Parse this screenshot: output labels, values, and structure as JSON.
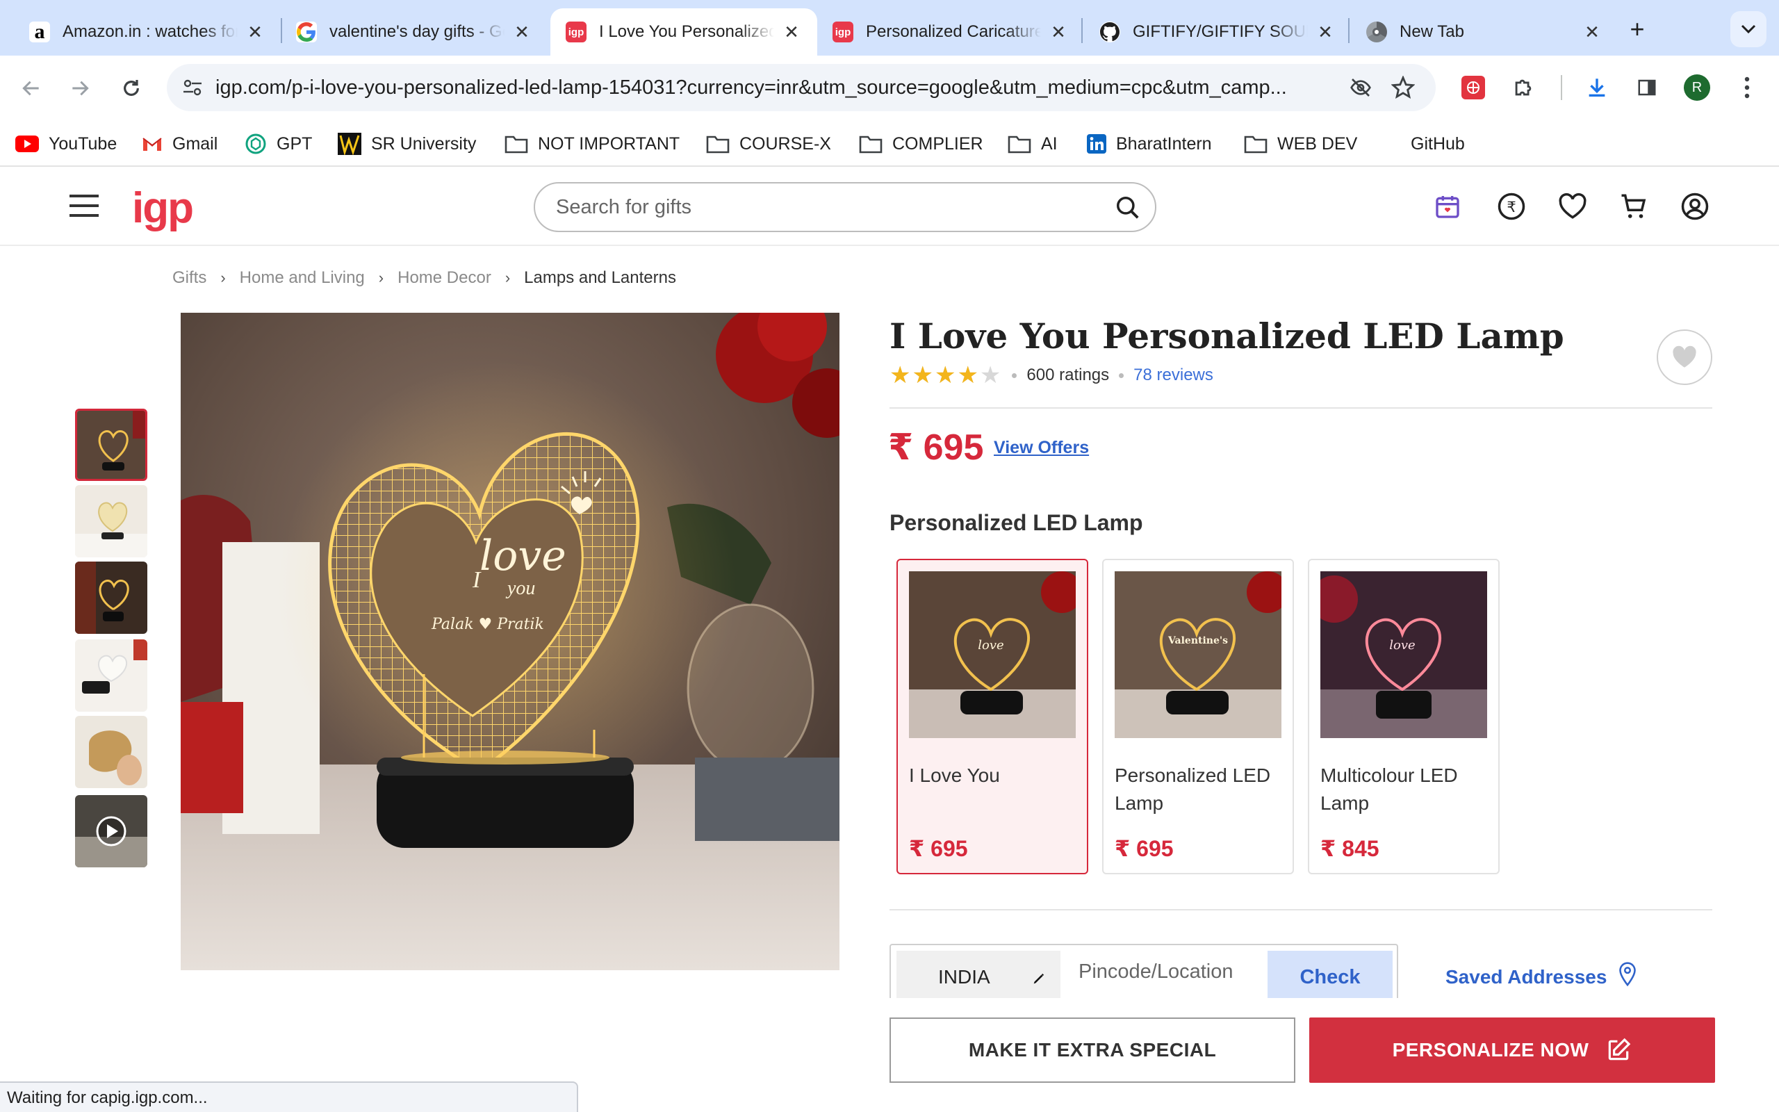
{
  "browser": {
    "tabs": [
      {
        "title": "Amazon.in : watches for women",
        "favicon": "amazon-icon"
      },
      {
        "title": "valentine's day gifts - Google Search",
        "favicon": "google-icon"
      },
      {
        "title": "I Love You Personalized LED Lamp",
        "favicon": "igp-icon"
      },
      {
        "title": "Personalized Caricature Gifts",
        "favicon": "igp-icon"
      },
      {
        "title": "GIFTIFY/GIFTIFY SOURCE CODE",
        "favicon": "github-icon"
      },
      {
        "title": "New Tab",
        "favicon": "chrome-icon"
      }
    ],
    "favicon_text": "igp",
    "url": "igp.com/p-i-love-you-personalized-led-lamp-154031?currency=inr&utm_source=google&utm_medium=cpc&utm_camp...",
    "profile_initial": "R",
    "status_text": "Waiting for capig.igp.com...",
    "bookmarks": [
      {
        "label": "YouTube",
        "icon": "youtube-icon"
      },
      {
        "label": "Gmail",
        "icon": "gmail-icon"
      },
      {
        "label": "GPT",
        "icon": "gpt-icon"
      },
      {
        "label": "SR University",
        "icon": "sr-university-icon"
      },
      {
        "label": "NOT IMPORTANT",
        "icon": "folder-icon"
      },
      {
        "label": "COURSE-X",
        "icon": "folder-icon"
      },
      {
        "label": "COMPLIER",
        "icon": "folder-icon"
      },
      {
        "label": "AI",
        "icon": "folder-icon"
      },
      {
        "label": "BharatIntern",
        "icon": "linkedin-icon"
      },
      {
        "label": "WEB DEV",
        "icon": "folder-icon"
      },
      {
        "label": "GitHub",
        "icon": "none"
      }
    ]
  },
  "site": {
    "logo": "igp",
    "search_placeholder": "Search for gifts",
    "breadcrumb": [
      "Gifts",
      "Home and Living",
      "Home Decor",
      "Lamps and Lanterns"
    ]
  },
  "product": {
    "title": "I Love You Personalized LED Lamp",
    "rating": 4,
    "ratings_text": "600 ratings",
    "reviews_text": "78 reviews",
    "price": "₹ 695",
    "view_offers": "View Offers",
    "lamp_text": {
      "big": "love",
      "small_top": "I",
      "small_bottom": "you",
      "names": "Palak ♥ Pratik"
    },
    "variant_section_title": "Personalized LED Lamp",
    "variants": [
      {
        "name": "I Love You",
        "price": "₹ 695",
        "selected": true
      },
      {
        "name": "Personalized LED Lamp",
        "price": "₹ 695",
        "selected": false
      },
      {
        "name": "Multicolour LED Lamp",
        "price": "₹ 845",
        "selected": false
      }
    ],
    "variant_image_text": [
      "love",
      "Valentine's"
    ],
    "pincode": {
      "country": "INDIA",
      "placeholder": "Pincode/Location",
      "check_label": "Check"
    },
    "saved_addresses": "Saved Addresses",
    "btn_special": "MAKE IT EXTRA SPECIAL",
    "btn_personalize": "PERSONALIZE NOW"
  },
  "colors": {
    "brand": "#e8394a",
    "price": "#d6283b",
    "link": "#2f62c9",
    "tabstrip": "#d3e3fd"
  }
}
